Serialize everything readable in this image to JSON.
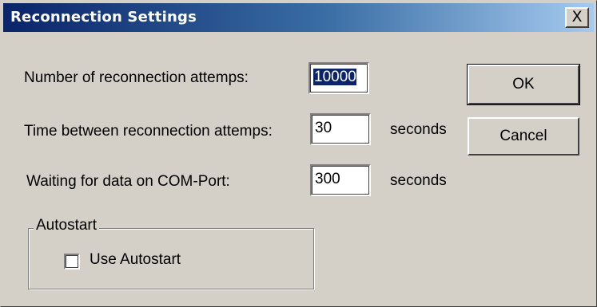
{
  "window": {
    "title": "Reconnection Settings",
    "close_glyph": "X"
  },
  "form": {
    "attempts": {
      "label": "Number of reconnection attemps:",
      "value": "10000"
    },
    "interval": {
      "label": "Time between reconnection attemps:",
      "value": "30",
      "unit": "seconds"
    },
    "com_wait": {
      "label": "Waiting for data on COM-Port:",
      "value": "300",
      "unit": "seconds"
    }
  },
  "autostart": {
    "group_label": "Autostart",
    "checkbox_label": "Use Autostart",
    "checked": false
  },
  "buttons": {
    "ok": "OK",
    "cancel": "Cancel"
  }
}
